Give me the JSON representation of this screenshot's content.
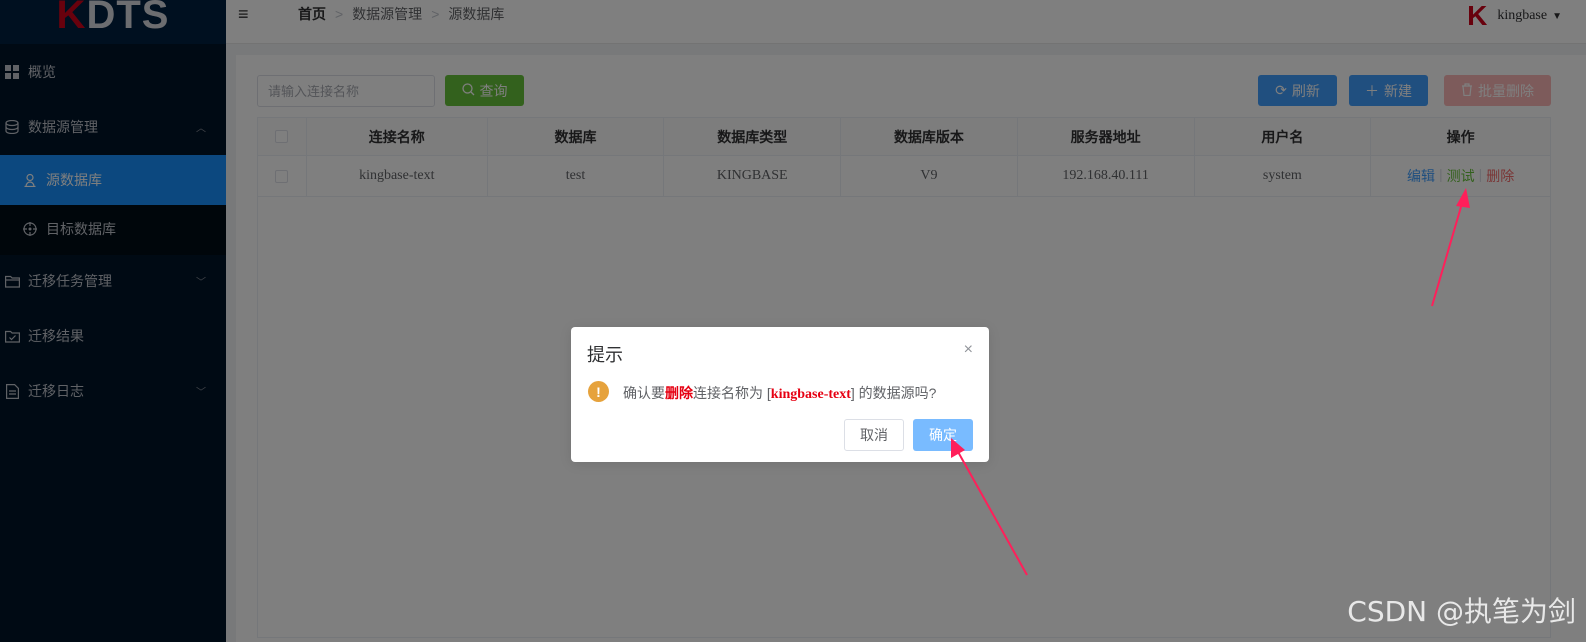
{
  "logo": {
    "k": "K",
    "rest": "DTS"
  },
  "sidebar": {
    "items": [
      {
        "label": "概览",
        "icon": "dashboard-icon"
      },
      {
        "label": "数据源管理",
        "icon": "database-icon",
        "expanded": true
      },
      {
        "label": "源数据库",
        "icon": "user-icon",
        "active": true
      },
      {
        "label": "目标数据库",
        "icon": "target-icon"
      },
      {
        "label": "迁移任务管理",
        "icon": "folder-icon"
      },
      {
        "label": "迁移结果",
        "icon": "check-icon"
      },
      {
        "label": "迁移日志",
        "icon": "document-icon"
      }
    ]
  },
  "header": {
    "hamburger": "≡",
    "breadcrumb": [
      "首页",
      "数据源管理",
      "源数据库"
    ],
    "separator": ">",
    "user": "kingbase",
    "user_logo": "K"
  },
  "toolbar": {
    "search_placeholder": "请输入连接名称",
    "query_label": "查询",
    "refresh_label": "刷新",
    "new_label": "新建",
    "batch_delete_label": "批量删除"
  },
  "table": {
    "columns": [
      "连接名称",
      "数据库",
      "数据库类型",
      "数据库版本",
      "服务器地址",
      "用户名",
      "操作"
    ],
    "rows": [
      {
        "name": "kingbase-text",
        "database": "test",
        "type": "KINGBASE",
        "version": "V9",
        "address": "192.168.40.111",
        "username": "system",
        "ops": {
          "edit": "编辑",
          "test": "测试",
          "delete": "删除"
        }
      }
    ]
  },
  "dialog": {
    "title": "提示",
    "close": "×",
    "icon": "!",
    "msg_prefix": "确认要",
    "msg_action": "删除",
    "msg_mid": "连接名称为 [",
    "msg_name": "kingbase-text",
    "msg_suffix": "] 的数据源吗?",
    "cancel_label": "取消",
    "ok_label": "确定"
  },
  "watermark": "CSDN @执笔为剑",
  "colors": {
    "sidebar_bg": "#001529",
    "active": "#1890ff",
    "primary": "#409eff",
    "success": "#67c23a",
    "danger": "#f56c6c",
    "warning": "#e6a23c",
    "arrow": "#ff1f5a"
  }
}
